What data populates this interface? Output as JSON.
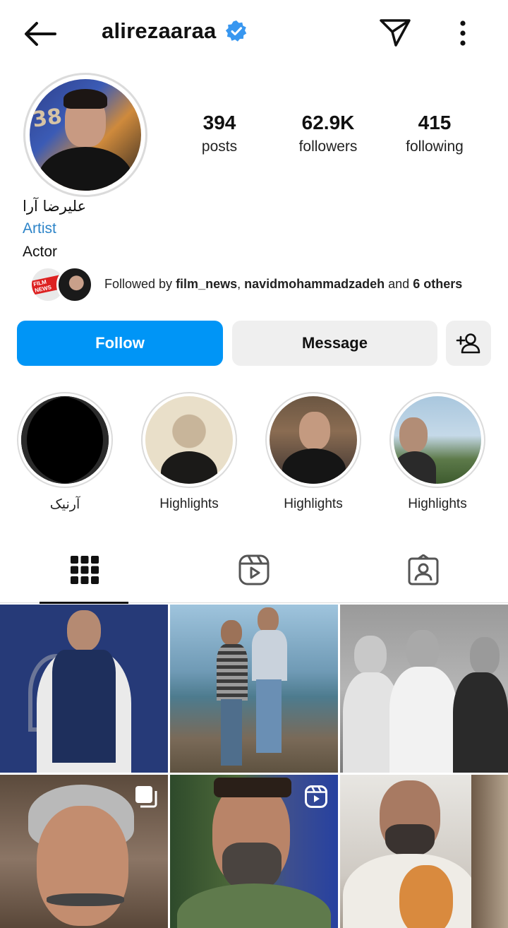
{
  "header": {
    "username": "alirezaaraa",
    "verified": true
  },
  "stats": {
    "posts": {
      "value": "394",
      "label": "posts"
    },
    "followers": {
      "value": "62.9K",
      "label": "followers"
    },
    "following": {
      "value": "415",
      "label": "following"
    }
  },
  "bio": {
    "display_name": "علیرضا آرا",
    "category": "Artist",
    "description": "Actor"
  },
  "followed_by": {
    "prefix": "Followed by ",
    "user1": "film_news",
    "separator": ", ",
    "user2": "navidmohammadzadeh",
    "middle": " and ",
    "others": "6 others",
    "badge_text": "FILM NEWS"
  },
  "actions": {
    "follow": "Follow",
    "message": "Message"
  },
  "highlights": [
    {
      "label": "آرنیک"
    },
    {
      "label": "Highlights"
    },
    {
      "label": "Highlights"
    },
    {
      "label": "Highlights"
    }
  ],
  "tabs": [
    {
      "icon": "grid-icon",
      "active": true
    },
    {
      "icon": "reels-icon",
      "active": false
    },
    {
      "icon": "tagged-icon",
      "active": false
    }
  ],
  "colors": {
    "primary_button": "#0095f6",
    "verified_badge": "#3897f0",
    "category_link": "#2d84c8",
    "secondary_button": "#efefef"
  }
}
